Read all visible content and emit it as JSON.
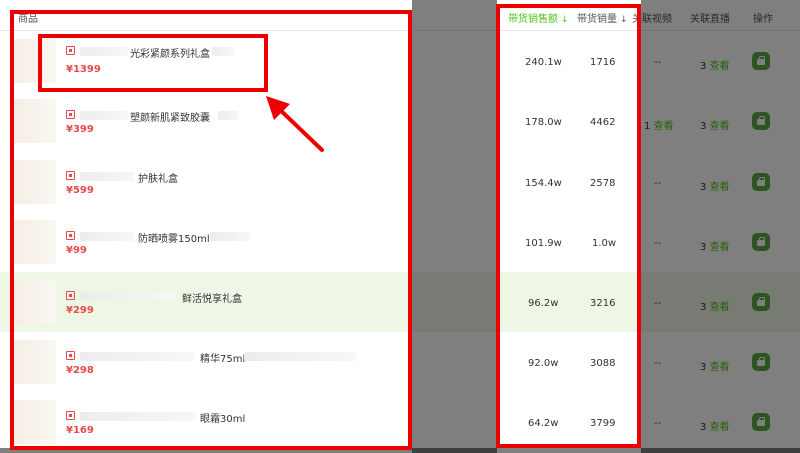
{
  "header": {
    "product": "商品",
    "sales_amount": "带货销售额",
    "sales_volume": "带货销量",
    "linked_videos": "关联视频",
    "linked_live": "关联直播",
    "action": "操作"
  },
  "view_label": "查看",
  "products": [
    {
      "name": "光彩紧颜系列礼盒",
      "price": "¥1399",
      "sales_amount": "240.1w",
      "sales_volume": "1716",
      "videos": "--",
      "live_count": "3"
    },
    {
      "name": "塑颜新肌紧致胶囊",
      "price": "¥399",
      "sales_amount": "178.0w",
      "sales_volume": "4462",
      "videos": "1",
      "live_count": "3"
    },
    {
      "name": "护肤礼盒",
      "price": "¥599",
      "sales_amount": "154.4w",
      "sales_volume": "2578",
      "videos": "--",
      "live_count": "3"
    },
    {
      "name": "防晒喷雾150ml",
      "price": "¥99",
      "sales_amount": "101.9w",
      "sales_volume": "1.0w",
      "videos": "--",
      "live_count": "3"
    },
    {
      "name": "鲜活悦享礼盒",
      "price": "¥299",
      "sales_amount": "96.2w",
      "sales_volume": "3216",
      "videos": "--",
      "live_count": "3"
    },
    {
      "name": "精华75ml",
      "price": "¥298",
      "sales_amount": "92.0w",
      "sales_volume": "3088",
      "videos": "--",
      "live_count": "3"
    },
    {
      "name": "眼霜30ml",
      "price": "¥169",
      "sales_amount": "64.2w",
      "sales_volume": "3799",
      "videos": "--",
      "live_count": "3"
    }
  ],
  "colors": {
    "accent": "#52c41a",
    "price": "#e84a4a",
    "annotation": "#ee0000",
    "highlight_row": "#eef7e6"
  }
}
